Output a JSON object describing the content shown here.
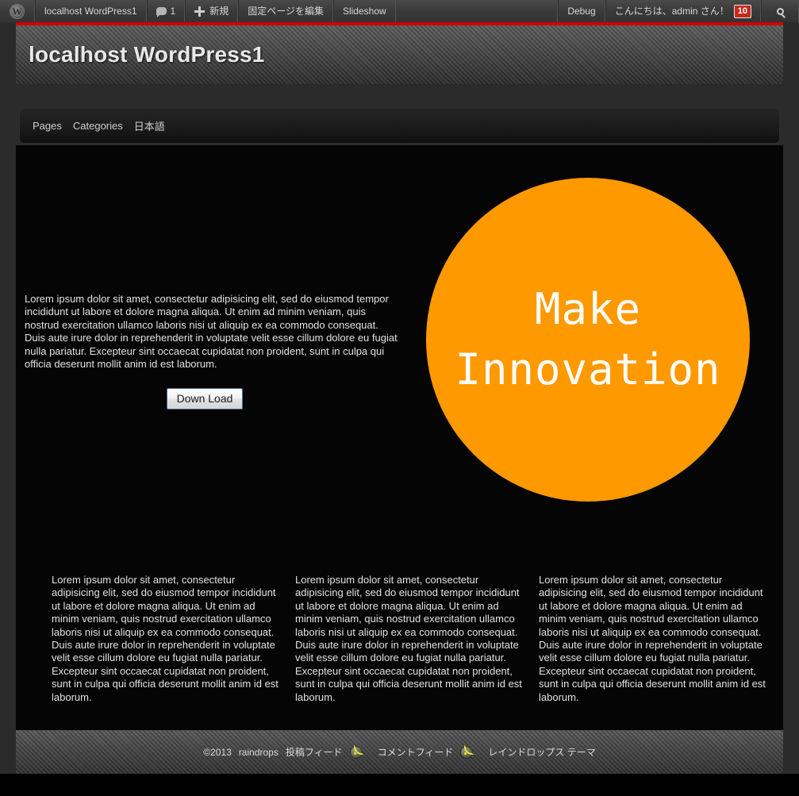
{
  "admin_bar": {
    "logo_icon": "wordpress-logo-icon",
    "logo_glyph": "W",
    "site_name": "localhost WordPress1",
    "comments_icon": "comment-bubble-icon",
    "comments_count": "1",
    "new_icon": "plus-icon",
    "new_label": "新規",
    "edit_page_label": "固定ページを編集",
    "slideshow_label": "Slideshow",
    "debug_label": "Debug",
    "greeting": "こんにちは、admin さん！",
    "notification_badge": "10",
    "search_icon": "search-icon",
    "badge_color": "#c42a1c"
  },
  "header": {
    "title": "localhost WordPress1",
    "accent_rule_color": "#cf0000"
  },
  "nav": {
    "items": [
      {
        "label": "Pages"
      },
      {
        "label": "Categories"
      },
      {
        "label": "日本語"
      }
    ]
  },
  "hero": {
    "circle_color": "#ff9900",
    "line1": "Make",
    "line2": "Innovation"
  },
  "intro": {
    "text": "Lorem ipsum dolor sit amet, consectetur adipisicing elit, sed do eiusmod tempor incididunt ut labore et dolore magna aliqua. Ut enim ad minim veniam, quis nostrud exercitation ullamco laboris nisi ut aliquip ex ea commodo consequat. Duis aute irure dolor in reprehenderit in voluptate velit esse cillum dolore eu fugiat nulla pariatur. Excepteur sint occaecat cupidatat non proident, sunt in culpa qui officia deserunt mollit anim id est laborum.",
    "download_label": "Down Load"
  },
  "columns": [
    {
      "text": "Lorem ipsum dolor sit amet, consectetur adipisicing elit, sed do eiusmod tempor incididunt ut labore et dolore magna aliqua. Ut enim ad minim veniam, quis nostrud exercitation ullamco laboris nisi ut aliquip ex ea commodo consequat. Duis aute irure dolor in reprehenderit in voluptate velit esse cillum dolore eu fugiat nulla pariatur. Excepteur sint occaecat cupidatat non proident, sunt in culpa qui officia deserunt mollit anim id est laborum."
    },
    {
      "text": "Lorem ipsum dolor sit amet, consectetur adipisicing elit, sed do eiusmod tempor incididunt ut labore et dolore magna aliqua. Ut enim ad minim veniam, quis nostrud exercitation ullamco laboris nisi ut aliquip ex ea commodo consequat. Duis aute irure dolor in reprehenderit in voluptate velit esse cillum dolore eu fugiat nulla pariatur. Excepteur sint occaecat cupidatat non proident, sunt in culpa qui officia deserunt mollit anim id est laborum."
    },
    {
      "text": "Lorem ipsum dolor sit amet, consectetur adipisicing elit, sed do eiusmod tempor incididunt ut labore et dolore magna aliqua. Ut enim ad minim veniam, quis nostrud exercitation ullamco laboris nisi ut aliquip ex ea commodo consequat. Duis aute irure dolor in reprehenderit in voluptate velit esse cillum dolore eu fugiat nulla pariatur. Excepteur sint occaecat cupidatat non proident, sunt in culpa qui officia deserunt mollit anim id est laborum."
    }
  ],
  "footer": {
    "copyright": "©2013",
    "site_name": "raindrops",
    "posts_feed_label": "投稿フィード",
    "posts_feed_icon": "rss-icon",
    "comments_feed_label": "コメントフィード",
    "comments_feed_icon": "rss-icon",
    "theme_label": "レインドロップス テーマ"
  }
}
